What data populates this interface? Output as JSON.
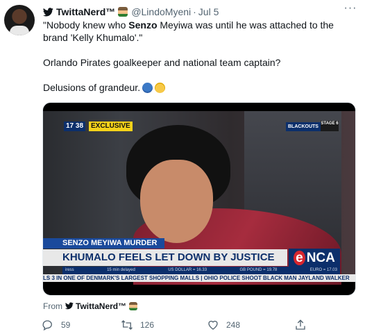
{
  "tweet": {
    "display_name": "TwittaNerd™",
    "handle": "@LindoMyeni",
    "date": "Jul 5",
    "more_label": "···",
    "line1_pre": "\"Nobody knew who ",
    "line1_bold": "Senzo",
    "line1_post": " Meyiwa was until he was attached to the brand 'Kelly Khumalo'.\"",
    "line2": "Orlando Pirates goalkeeper and national team captain?",
    "line3": "Delusions of grandeur.",
    "icons": [
      "twitter-bird-icon",
      "person-emoji-icon",
      "facepalm-emoji-icon",
      "exploding-head-emoji-icon"
    ]
  },
  "video": {
    "time_tag": "17 38",
    "exclusive_tag": "EXCLUSIVE",
    "show_tag": "BLACKOUTS",
    "stage_tag": "STAGE 6",
    "lower_third_small": "SENZO MEYIWA MURDER",
    "lower_third_main": "KHUMALO FEELS LET DOWN BY JUSTICE SYSTEM",
    "channel_logo_e": "e",
    "channel_logo_rest": "NCA",
    "ticker_info": [
      "iress",
      "15 min delayed",
      "US DOLLAR = 16.33",
      "GB POUND = 19.78",
      "EURO = 17.03"
    ],
    "ticker_news": "LS 3 IN ONE OF DENMARK'S LARGEST SHOPPING MALLS | OHIO POLICE SHOOT BLACK MAN JAYLAND WALKER"
  },
  "source": {
    "from_label": "From",
    "name": "TwittaNerd™"
  },
  "actions": {
    "replies": "59",
    "retweets": "126",
    "likes": "248"
  },
  "colors": {
    "text": "#0f1419",
    "secondary": "#536471",
    "enca_blue": "#0c2f6b",
    "enca_red": "#d7262e",
    "exclusive_yellow": "#f5d21a"
  }
}
